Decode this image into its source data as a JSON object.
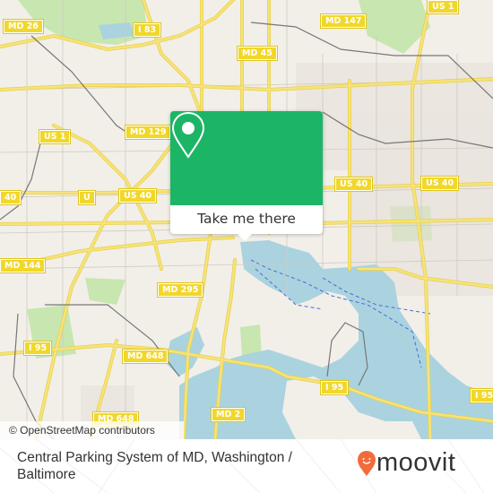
{
  "map": {
    "attribution": "© OpenStreetMap contributors",
    "colors": {
      "land": "#f2efe9",
      "water": "#aad3df",
      "park": "#c8e6b0",
      "road": "#f6e37a",
      "road_casing": "#e8d04a",
      "rail": "#777777",
      "ferry": "#4a6bd8",
      "shield": "#f1d72a",
      "popup_green": "#1cb566"
    },
    "road_labels": [
      {
        "id": "md26",
        "label": "MD 26"
      },
      {
        "id": "i83",
        "label": "I 83"
      },
      {
        "id": "md147",
        "label": "MD 147"
      },
      {
        "id": "us1-top",
        "label": "US 1"
      },
      {
        "id": "md45",
        "label": "MD 45"
      },
      {
        "id": "us1-left",
        "label": "US 1"
      },
      {
        "id": "md129",
        "label": "MD 129"
      },
      {
        "id": "us40-far-left",
        "label": "40"
      },
      {
        "id": "us40-u",
        "label": "U"
      },
      {
        "id": "us40-mid",
        "label": "US 40"
      },
      {
        "id": "us40-right1",
        "label": "US 40"
      },
      {
        "id": "us40-right2",
        "label": "US 40"
      },
      {
        "id": "md144",
        "label": "MD 144"
      },
      {
        "id": "md295",
        "label": "MD 295"
      },
      {
        "id": "i95-left",
        "label": "I 95"
      },
      {
        "id": "md648-upper",
        "label": "MD 648"
      },
      {
        "id": "i95-mid",
        "label": "I 95"
      },
      {
        "id": "i95-right",
        "label": "I 95"
      },
      {
        "id": "md648-lower",
        "label": "MD 648"
      },
      {
        "id": "md2",
        "label": "MD 2"
      }
    ]
  },
  "popup": {
    "icon": "location-pin-icon",
    "button_label": "Take me there"
  },
  "footer": {
    "title": "Central Parking System of MD, Washington / Baltimore",
    "logo_text": "moovit",
    "logo_icon": "moovit-pin-smile-icon",
    "logo_color": "#f26b3a"
  }
}
